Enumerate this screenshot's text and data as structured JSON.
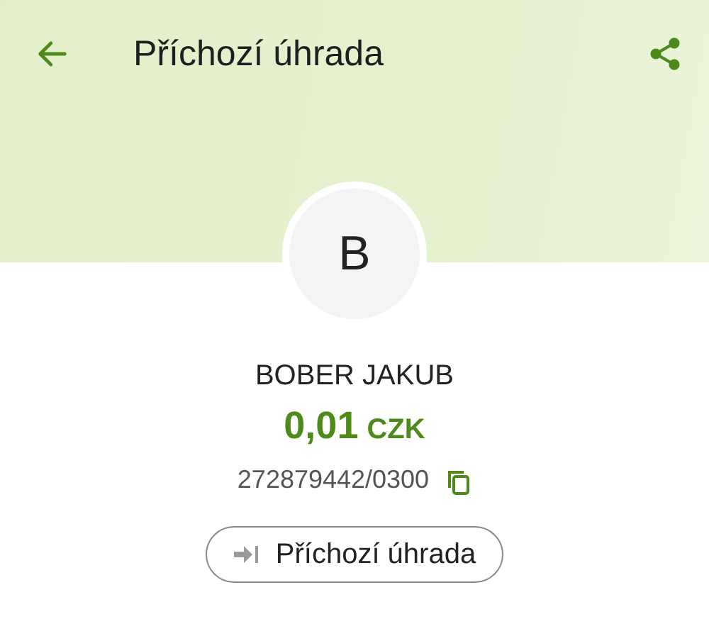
{
  "header": {
    "title": "Příchozí úhrada"
  },
  "avatar": {
    "initial": "B"
  },
  "name": "BOBER JAKUB",
  "amount": {
    "value": "0,01",
    "currency": "CZK"
  },
  "account": "272879442/0300",
  "chip": {
    "label": "Příchozí úhrada"
  }
}
